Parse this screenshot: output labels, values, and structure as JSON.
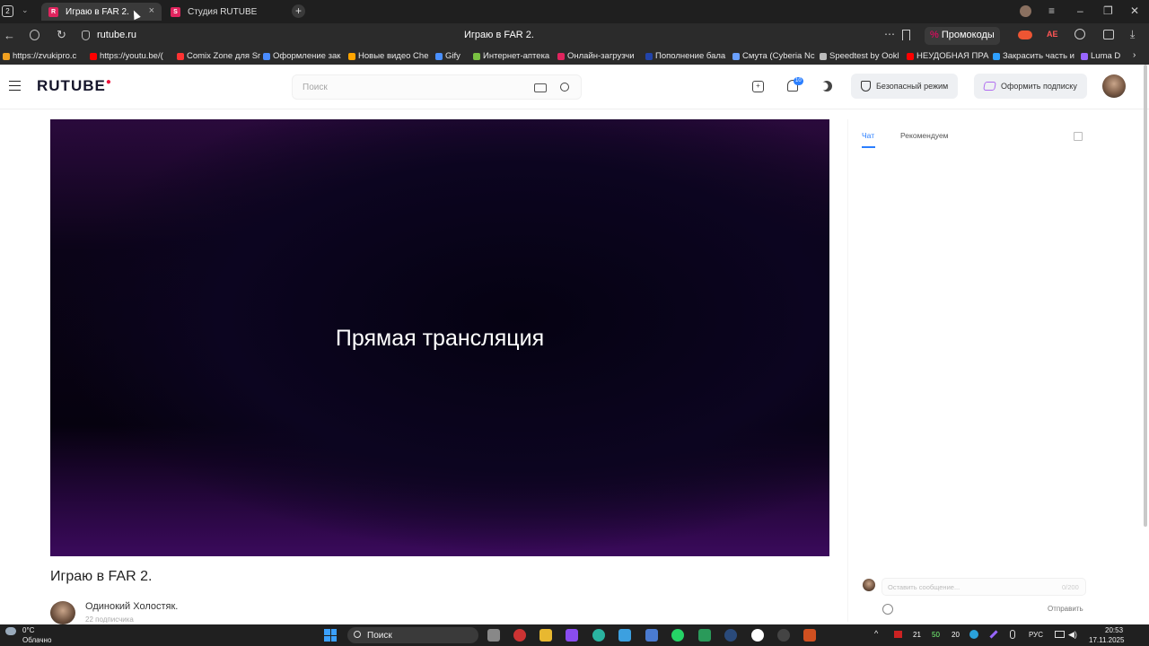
{
  "browser": {
    "tab_counter": "2",
    "tabs": [
      {
        "label": "Играю в FAR 2.",
        "active": true
      },
      {
        "label": "Студия RUTUBE",
        "active": false
      }
    ],
    "url": "rutube.ru",
    "page_title": "Играю в FAR 2.",
    "promo_label": "Промокоды",
    "bookmarks": [
      {
        "label": "https://zvukipro.c",
        "color": "#f0a020"
      },
      {
        "label": "https://youtu.be/(",
        "color": "#ff0000"
      },
      {
        "label": "Comix Zone для Sr",
        "color": "#ff3333"
      },
      {
        "label": "Оформление зак",
        "color": "#4a8cff"
      },
      {
        "label": "Новые видео Che",
        "color": "#ffa500"
      },
      {
        "label": "Gify",
        "color": "#4a90ff"
      },
      {
        "label": "Интернет-аптека",
        "color": "#7ac142"
      },
      {
        "label": "Онлайн-загрузчи",
        "color": "#e0245e"
      },
      {
        "label": "Пополнение бала",
        "color": "#2244aa"
      },
      {
        "label": "Смута (Cyberia Nc",
        "color": "#6aa0ff"
      },
      {
        "label": "Speedtest by Ookl",
        "color": "#bbbbbb"
      },
      {
        "label": "НЕУДОБНАЯ ПРА",
        "color": "#ff0000"
      },
      {
        "label": "Закрасить часть и",
        "color": "#2fa0ff"
      },
      {
        "label": "Luma D",
        "color": "#9966ff"
      }
    ]
  },
  "site": {
    "logo": "RUTUBE",
    "search_placeholder": "Поиск",
    "safe_mode_label": "Безопасный режим",
    "subscribe_label": "Оформить подписку",
    "notification_count": "10"
  },
  "player": {
    "overlay_text": "Прямая трансляция"
  },
  "video": {
    "title": "Играю в FAR 2.",
    "channel_name": "Одинокий Холостяк.",
    "subscribers": "22 подписчика"
  },
  "chat": {
    "tabs": [
      "Чат",
      "Рекомендуем"
    ],
    "input_placeholder": "Оставить сообщение...",
    "char_counter": "0/200",
    "send_label": "Отправить"
  },
  "taskbar": {
    "weather_temp": "0°C",
    "weather_desc": "Облачно",
    "search_label": "Поиск",
    "language": "РУС",
    "time": "20:53",
    "date": "17.11.2025",
    "tray_numbers": [
      "21",
      "50",
      "20"
    ]
  },
  "colors": {
    "brand_red": "#ed143d",
    "accent_blue": "#2b7fff"
  }
}
